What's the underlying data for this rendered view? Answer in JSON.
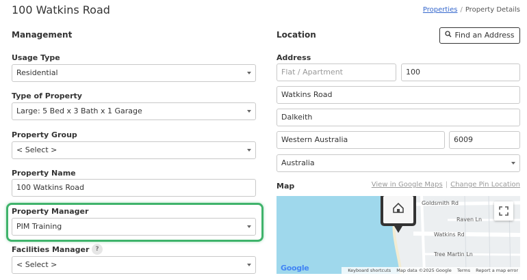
{
  "header": {
    "title": "100 Watkins Road",
    "breadcrumb": {
      "link": "Properties",
      "separator": "/",
      "current": "Property Details"
    }
  },
  "management": {
    "heading": "Management",
    "usage_type": {
      "label": "Usage Type",
      "value": "Residential"
    },
    "type_of_property": {
      "label": "Type of Property",
      "value": "Large: 5 Bed x 3 Bath x 1 Garage"
    },
    "property_group": {
      "label": "Property Group",
      "value": "< Select >"
    },
    "property_name": {
      "label": "Property Name",
      "value": "100 Watkins Road"
    },
    "property_manager": {
      "label": "Property Manager",
      "value": "PIM Training"
    },
    "facilities_manager": {
      "label": "Facilities Manager",
      "help": "?",
      "value": "< Select >"
    }
  },
  "location": {
    "heading": "Location",
    "find_address_button": "Find an Address",
    "address_label": "Address",
    "flat_placeholder": "Flat / Apartment",
    "street_number": "100",
    "street": "Watkins Road",
    "suburb": "Dalkeith",
    "state": "Western Australia",
    "postcode": "6009",
    "country": "Australia"
  },
  "map": {
    "label": "Map",
    "view_link": "View in Google Maps",
    "change_pin_link": "Change Pin Location",
    "streets": [
      "Goldsmith Rd",
      "Raven Ln",
      "Watkins Rd",
      "Tree Martin Ln"
    ],
    "logo": "Google",
    "footer": [
      "Keyboard shortcuts",
      "Map data ©2025 Google",
      "Terms",
      "Report a map error"
    ]
  },
  "colors": {
    "highlight": "#3fb36b",
    "link": "#3366cc",
    "water": "#9fd8ec"
  }
}
